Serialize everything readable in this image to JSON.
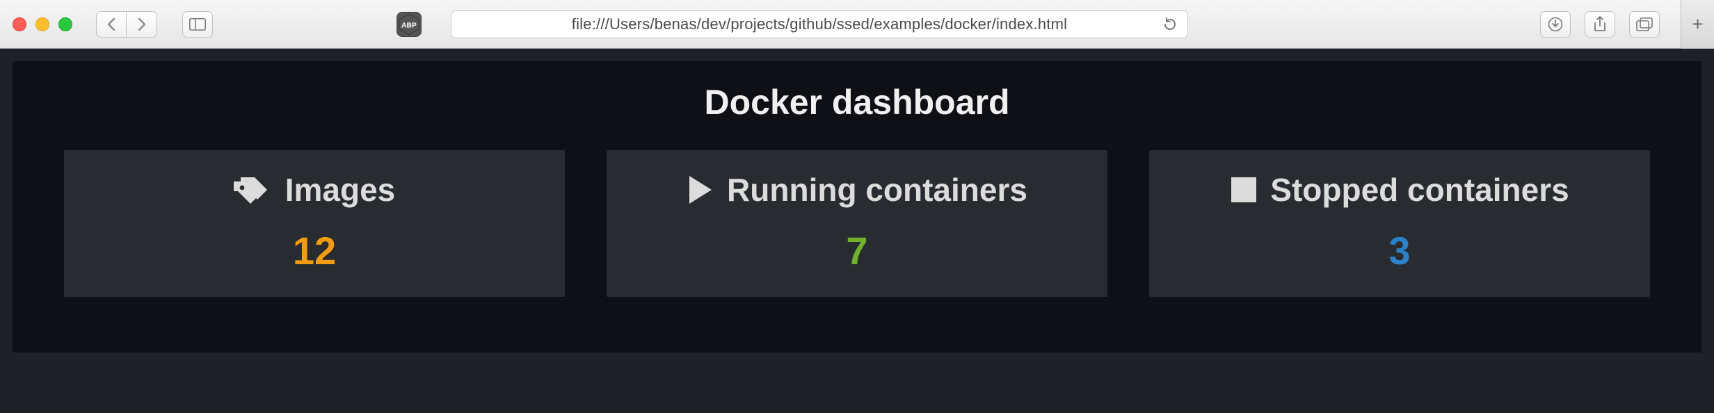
{
  "browser": {
    "abp_label": "ABP",
    "url": "file:///Users/benas/dev/projects/github/ssed/examples/docker/index.html"
  },
  "page": {
    "title": "Docker dashboard"
  },
  "cards": {
    "images": {
      "label": "Images",
      "value": "12",
      "value_color": "#f39c11"
    },
    "running": {
      "label": "Running containers",
      "value": "7",
      "value_color": "#6fb02c"
    },
    "stopped": {
      "label": "Stopped containers",
      "value": "3",
      "value_color": "#2c82c9"
    }
  }
}
